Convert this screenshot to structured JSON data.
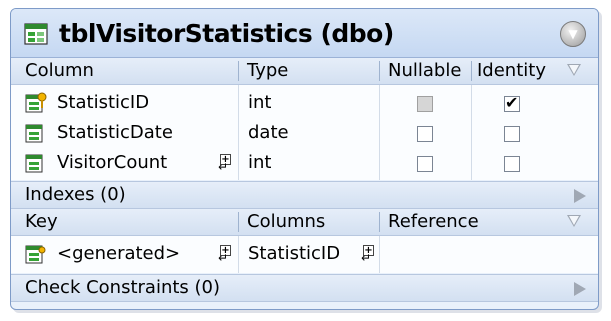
{
  "table": {
    "title": "tblVisitorStatistics (dbo)",
    "icon": "table-icon",
    "collapse_icon": "chevron-down-icon"
  },
  "columns_section": {
    "headers": [
      "Column",
      "Type",
      "Nullable",
      "Identity"
    ],
    "rows": [
      {
        "name": "StatisticID",
        "type": "int",
        "nullable": false,
        "nullable_disabled": true,
        "identity": true,
        "icon": "primary-key-column-icon"
      },
      {
        "name": "StatisticDate",
        "type": "date",
        "nullable": false,
        "nullable_disabled": false,
        "identity": false,
        "icon": "column-icon"
      },
      {
        "name": "VisitorCount",
        "type": "int",
        "nullable": false,
        "nullable_disabled": false,
        "identity": false,
        "icon": "column-icon"
      }
    ]
  },
  "indexes_section": {
    "label": "Indexes (0)"
  },
  "keys_section": {
    "headers": [
      "Key",
      "Columns",
      "Reference"
    ],
    "rows": [
      {
        "key": "<generated>",
        "columns": "StatisticID",
        "reference": "",
        "icon": "key-icon"
      }
    ]
  },
  "check_section": {
    "label": "Check Constraints (0)"
  },
  "colors": {
    "frame_border": "#7e9bc8",
    "header_bg": "#dce8f8",
    "row_bg": "#fbfdff"
  }
}
